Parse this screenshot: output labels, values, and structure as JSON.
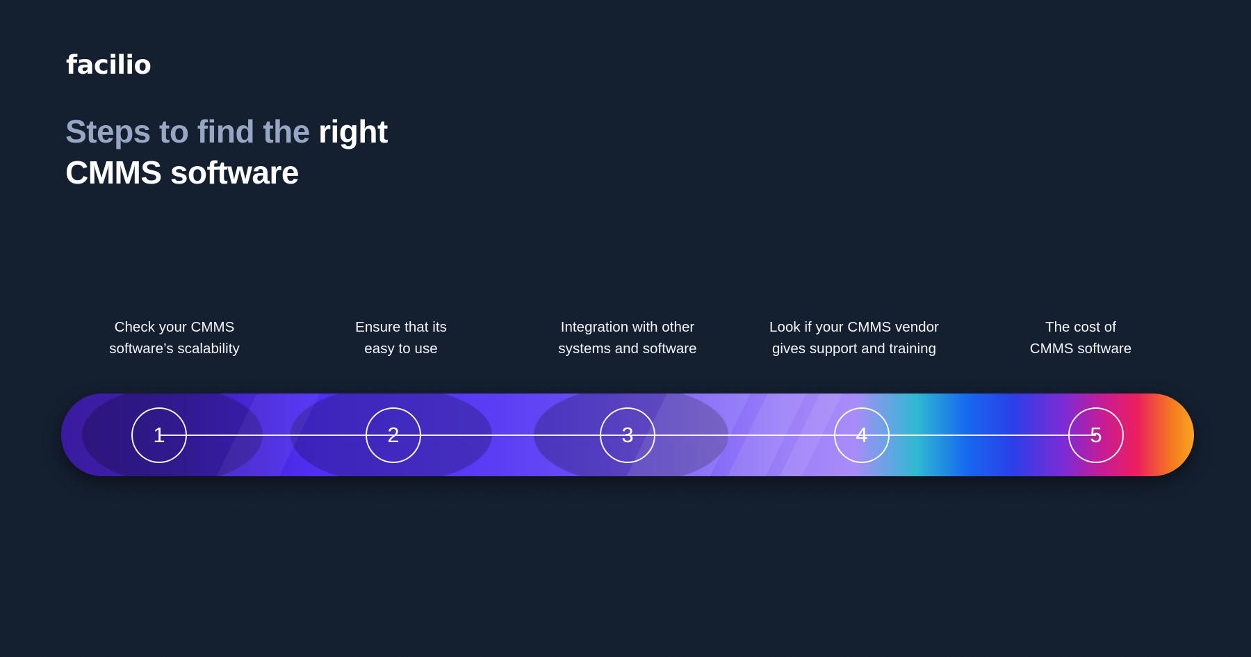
{
  "brand": {
    "name": "facilio"
  },
  "headline": {
    "line1_muted": "Steps to find the ",
    "line1_bright": "right",
    "line2_bright": "CMMS software"
  },
  "colors": {
    "background": "#131d2d",
    "headline_muted": "#96a6c3",
    "headline_bright": "#ffffff",
    "label_text": "#f2f5fa",
    "node_stroke": "#ffffff",
    "gradient_start": "#3a1b9e",
    "gradient_mid_violet": "#5436f5",
    "gradient_light_purple": "#a98cf8",
    "gradient_teal": "#2fb9d2",
    "gradient_blue": "#1668ef",
    "gradient_magenta": "#c81c94",
    "gradient_pink": "#ec1f5e",
    "gradient_orange": "#f9a520"
  },
  "steps": [
    {
      "number": "1",
      "line1": "Check your CMMS",
      "line2": "software’s scalability"
    },
    {
      "number": "2",
      "line1": "Ensure that its",
      "line2": "easy to use"
    },
    {
      "number": "3",
      "line1": "Integration with other",
      "line2": "systems and software"
    },
    {
      "number": "4",
      "line1": "Look if your CMMS vendor",
      "line2": "gives support and training"
    },
    {
      "number": "5",
      "line1": "The cost of",
      "line2": "CMMS software"
    }
  ]
}
